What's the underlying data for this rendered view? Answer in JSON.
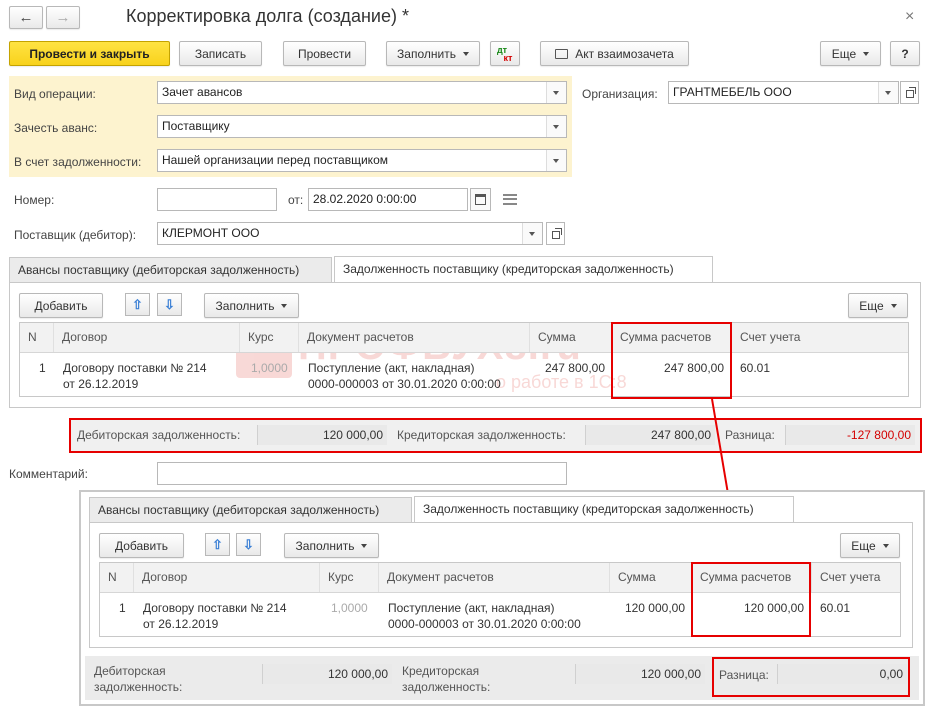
{
  "window": {
    "title": "Корректировка долга (создание) *",
    "back_icon": "left-arrow-icon",
    "forward_icon": "right-arrow-icon",
    "close_icon": "close-icon"
  },
  "toolbar": {
    "post_close": "Провести и закрыть",
    "save": "Записать",
    "post": "Провести",
    "fill": "Заполнить",
    "dt_kt_top": "дт",
    "dt_kt_bottom": "кт",
    "act": "Акт взаимозачета",
    "more": "Еще",
    "help": "?"
  },
  "form": {
    "operation_label": "Вид операции:",
    "operation_value": "Зачет авансов",
    "offset_label": "Зачесть аванс:",
    "offset_value": "Поставщику",
    "debt_label": "В счет задолженности:",
    "debt_value": "Нашей организации перед поставщиком",
    "org_label": "Организация:",
    "org_value": "ГРАНТМЕБЕЛЬ ООО",
    "number_label": "Номер:",
    "number_value": "",
    "date_label": "от:",
    "date_value": "28.02.2020  0:00:00",
    "supplier_label": "Поставщик (дебитор):",
    "supplier_value": "КЛЕРМОНТ ООО",
    "comment_label": "Комментарий:",
    "comment_value": ""
  },
  "tabs": {
    "advances": "Авансы поставщику (дебиторская задолженность)",
    "debt": "Задолженность поставщику (кредиторская задолженность)"
  },
  "table_toolbar": {
    "add": "Добавить",
    "fill": "Заполнить",
    "more": "Еще"
  },
  "columns": {
    "n": "N",
    "contract": "Договор",
    "rate": "Курс",
    "document": "Документ расчетов",
    "amount": "Сумма",
    "settlement": "Сумма расчетов",
    "account": "Счет учета"
  },
  "row_top": {
    "n": "1",
    "contract_line1": "Договору поставки № 214",
    "contract_line2": "от 26.12.2019",
    "rate": "1,0000",
    "doc_line1": "Поступление (акт, накладная)",
    "doc_line2": "0000-000003 от 30.01.2020 0:00:00",
    "amount": "247 800,00",
    "settlement": "247 800,00",
    "account": "60.01"
  },
  "totals_top": {
    "debit_label": "Дебиторская задолженность:",
    "debit_value": "120 000,00",
    "credit_label": "Кредиторская задолженность:",
    "credit_value": "247 800,00",
    "diff_label": "Разница:",
    "diff_value": "-127 800,00"
  },
  "row_bottom": {
    "n": "1",
    "contract_line1": "Договору поставки № 214",
    "contract_line2": "от 26.12.2019",
    "rate": "1,0000",
    "doc_line1": "Поступление (акт, накладная)",
    "doc_line2": "0000-000003 от 30.01.2020 0:00:00",
    "amount": "120 000,00",
    "settlement": "120 000,00",
    "account": "60.01"
  },
  "totals_bottom": {
    "debit_label_1": "Дебиторская",
    "debit_label_2": "задолженность:",
    "debit_value": "120 000,00",
    "credit_label_1": "Кредиторская",
    "credit_label_2": "задолженность:",
    "credit_value": "120 000,00",
    "diff_label": "Разница:",
    "diff_value": "0,00"
  },
  "watermark": {
    "text": "ПРОФБУХ8.ru",
    "sub": "о работе в 1С:8"
  },
  "colors": {
    "accent_yellow": "#f8d21c",
    "highlight_red": "#e60000",
    "negative_red": "#d40000",
    "field_group_bg": "#fdf3cf"
  }
}
